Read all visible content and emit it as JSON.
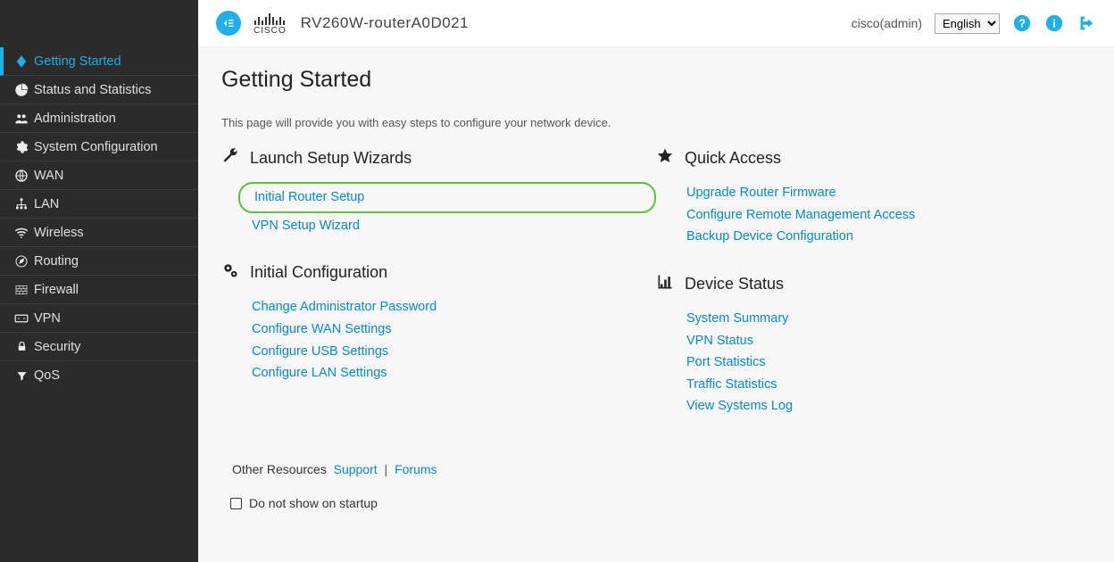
{
  "header": {
    "device_name": "RV260W-routerA0D021",
    "username": "cisco(admin)",
    "language_selected": "English",
    "cisco_label": "CISCO"
  },
  "sidebar": {
    "items": [
      {
        "label": "Getting Started",
        "icon": "diamond",
        "active": true
      },
      {
        "label": "Status and Statistics",
        "icon": "pie",
        "active": false
      },
      {
        "label": "Administration",
        "icon": "users",
        "active": false
      },
      {
        "label": "System Configuration",
        "icon": "gear",
        "active": false
      },
      {
        "label": "WAN",
        "icon": "globe",
        "active": false
      },
      {
        "label": "LAN",
        "icon": "sitemap",
        "active": false
      },
      {
        "label": "Wireless",
        "icon": "wifi",
        "active": false
      },
      {
        "label": "Routing",
        "icon": "compass",
        "active": false
      },
      {
        "label": "Firewall",
        "icon": "wall",
        "active": false
      },
      {
        "label": "VPN",
        "icon": "vpn",
        "active": false
      },
      {
        "label": "Security",
        "icon": "lock",
        "active": false
      },
      {
        "label": "QoS",
        "icon": "filter",
        "active": false
      }
    ]
  },
  "page": {
    "title": "Getting Started",
    "intro": "This page will provide you with easy steps to configure your network device.",
    "sections": {
      "launch_wizards": {
        "heading": "Launch Setup Wizards",
        "links": [
          "Initial Router Setup",
          "VPN Setup Wizard"
        ]
      },
      "quick_access": {
        "heading": "Quick Access",
        "links": [
          "Upgrade Router Firmware",
          "Configure Remote Management Access",
          "Backup Device Configuration"
        ]
      },
      "initial_config": {
        "heading": "Initial Configuration",
        "links": [
          "Change Administrator Password",
          "Configure WAN Settings",
          "Configure USB Settings",
          "Configure LAN Settings"
        ]
      },
      "device_status": {
        "heading": "Device Status",
        "links": [
          "System Summary",
          "VPN Status",
          "Port Statistics",
          "Traffic Statistics",
          "View Systems Log"
        ]
      }
    },
    "other_resources": {
      "label": "Other Resources",
      "support": "Support",
      "forums": "Forums"
    },
    "dont_show_label": "Do not show on startup"
  }
}
